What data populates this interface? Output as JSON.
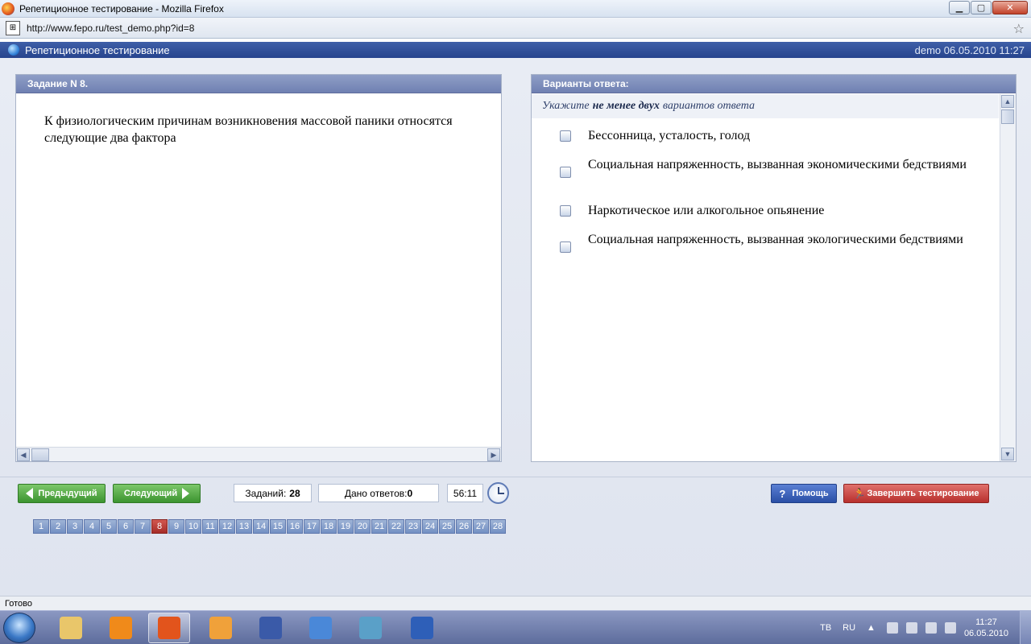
{
  "window": {
    "title": "Репетиционное тестирование - Mozilla Firefox",
    "controls": {
      "minimize": "▁",
      "maximize": "▢",
      "close": "✕"
    }
  },
  "browser": {
    "url": "http://www.fepo.ru/test_demo.php?id=8",
    "favicon_text": "⊞",
    "status": "Готово"
  },
  "app": {
    "title": "Репетиционное тестирование",
    "user_date": "demo 06.05.2010 11:27"
  },
  "task": {
    "header": "Задание N 8.",
    "text": "К физиологическим причинам возникновения массовой паники относятся следующие два фактора"
  },
  "answers": {
    "header": "Варианты ответа:",
    "hint_prefix": "Укажите",
    "hint_bold": "не менее двух",
    "hint_suffix": "вариантов ответа",
    "options": [
      {
        "label": "Бессонница, усталость, голод",
        "checked": false
      },
      {
        "label": "Социальная напряженность, вызванная экономическими бедствиями",
        "checked": false
      },
      {
        "label": "Наркотическое или алкогольное опьянение",
        "checked": false
      },
      {
        "label": "Социальная напряженность, вызванная экологическими бедствиями",
        "checked": false
      }
    ]
  },
  "nav": {
    "prev_label": "Предыдущий",
    "next_label": "Следующий",
    "tasks_label": "Заданий:",
    "tasks_count": "28",
    "answered_label": "Дано ответов:",
    "answered_count": "0",
    "timer": "56:11",
    "help_label": "Помощь",
    "finish_label": "Завершить тестирование",
    "current_page": 8,
    "pages": [
      "1",
      "2",
      "3",
      "4",
      "5",
      "6",
      "7",
      "8",
      "9",
      "10",
      "11",
      "12",
      "13",
      "14",
      "15",
      "16",
      "17",
      "18",
      "19",
      "20",
      "21",
      "22",
      "23",
      "24",
      "25",
      "26",
      "27",
      "28"
    ]
  },
  "taskbar": {
    "apps": [
      {
        "name": "explorer",
        "color": "#e9c66a"
      },
      {
        "name": "vlc",
        "color": "#f08a1a"
      },
      {
        "name": "firefox",
        "color": "#e2541c",
        "active": true
      },
      {
        "name": "media-player",
        "color": "#f0a13a"
      },
      {
        "name": "save",
        "color": "#3a5aa8"
      },
      {
        "name": "itunes",
        "color": "#4a88d8"
      },
      {
        "name": "photo-viewer",
        "color": "#5aa0c8"
      },
      {
        "name": "word",
        "color": "#2e5fb8"
      }
    ],
    "lang_tv": "ТВ",
    "lang_ru": "RU",
    "time": "11:27",
    "date": "06.05.2010"
  },
  "colors": {
    "accent": "#26448d",
    "panel_header": "#6f80b2",
    "active_page": "#a62c28"
  }
}
